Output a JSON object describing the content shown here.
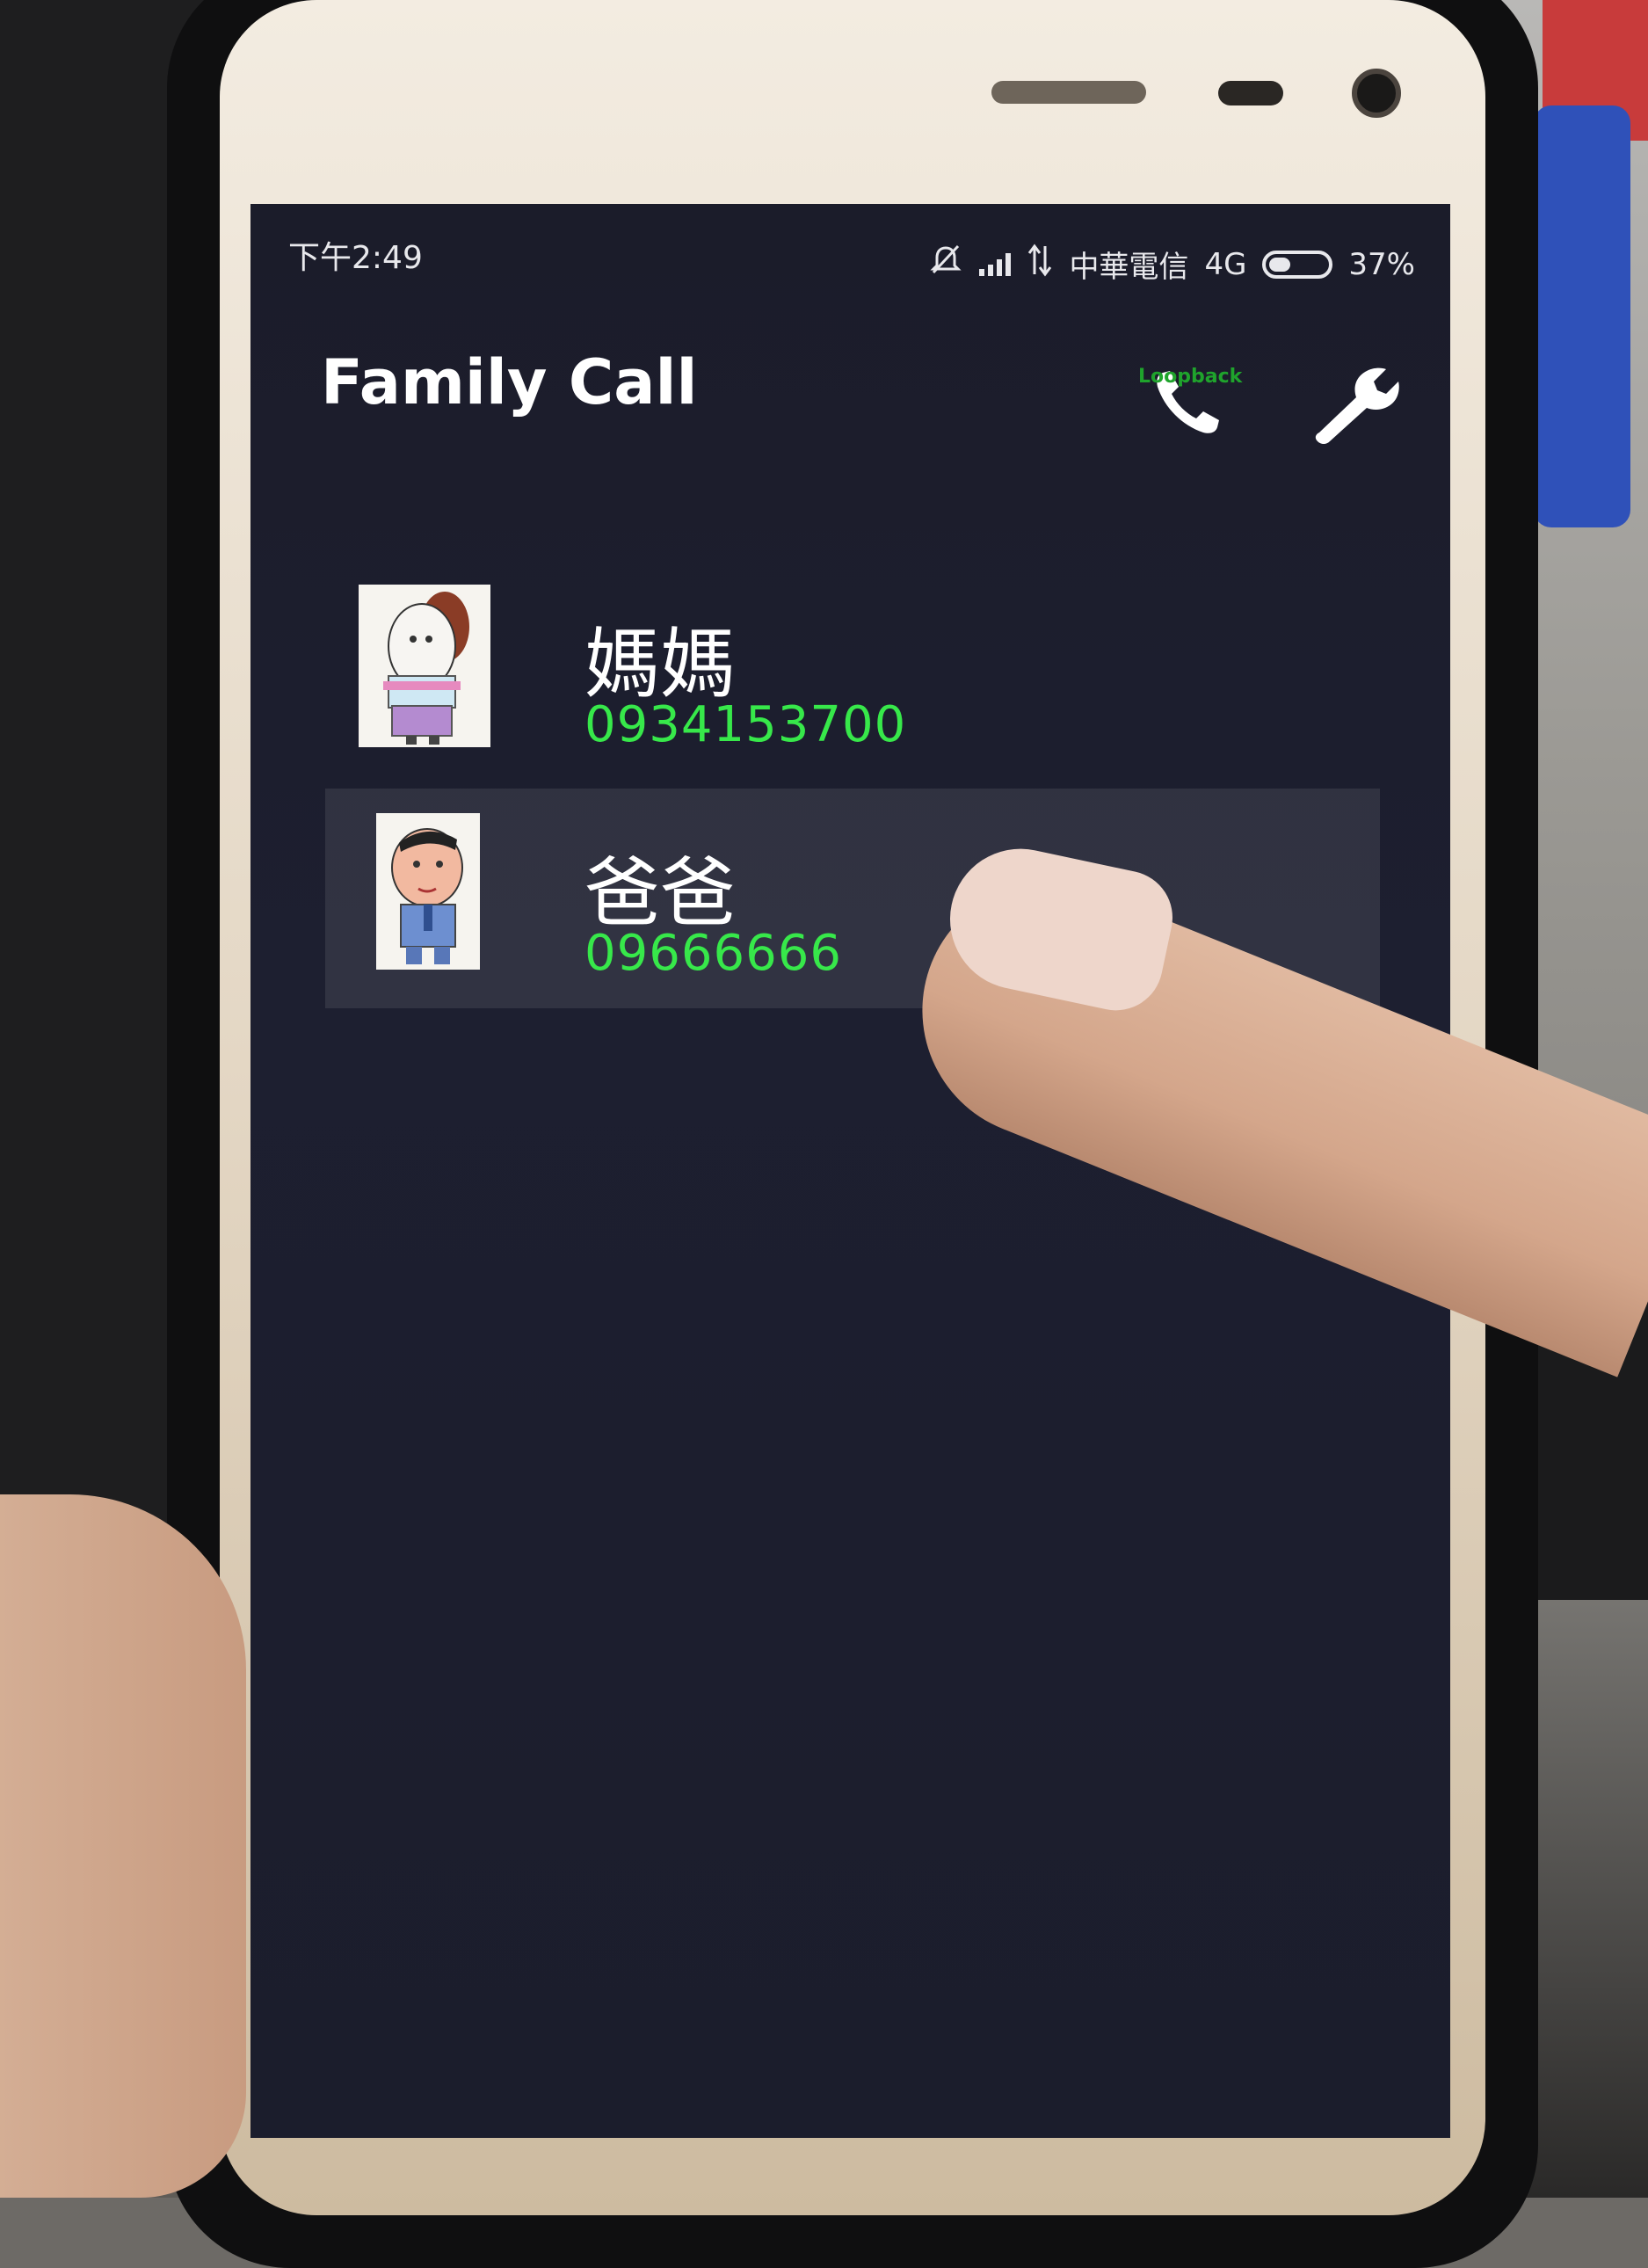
{
  "status_bar": {
    "time": "下午2:49",
    "carrier": "中華電信",
    "network": "4G",
    "battery_percent": "37%",
    "battery_level": 0.37
  },
  "app": {
    "title": "Family Call",
    "loopback_label": "Loopback"
  },
  "contacts": [
    {
      "name": "媽媽",
      "phone": "0934153700",
      "selected": false
    },
    {
      "name": "爸爸",
      "phone": "09666666",
      "selected": true
    }
  ],
  "colors": {
    "phone_number": "#37e84a",
    "loopback": "#1fa32c",
    "background": "#1c1e2d"
  }
}
